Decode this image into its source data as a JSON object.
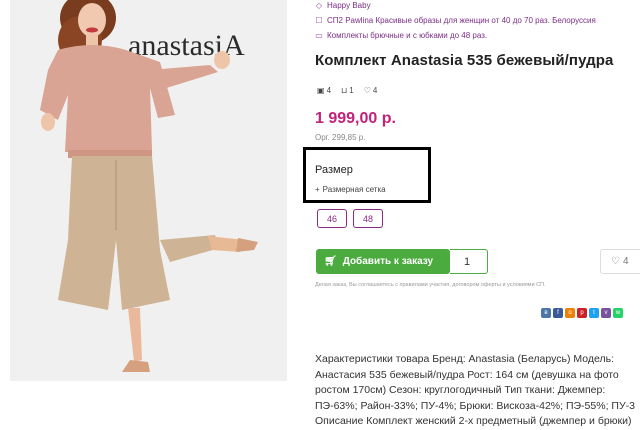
{
  "meta": {
    "brand_link": "Happy Baby",
    "purchase_link": "СП2 Pawlina Красивые образы для женщин от 40 до 70 раз. Белоруссия",
    "category_link": "Комплекты брючные и с юбками до 48 раз."
  },
  "product": {
    "title": "Комплект Anastasia 535 бежевый/пудра",
    "photo_logo": "anastasiA",
    "stats": {
      "photos": "4",
      "orders": "1",
      "likes": "4"
    },
    "price": "1 999,00 р.",
    "org_price": "Орг. 299,85 р."
  },
  "size": {
    "label": "Размер",
    "grid_link": "Размерная сетка",
    "options": [
      "46",
      "48"
    ]
  },
  "actions": {
    "add_label": "Добавить к заказу",
    "quantity": "1",
    "favorite_count": "4"
  },
  "disclaimer": "Делая заказ, Вы соглашаетесь с правилами участия, договором оферты и условиями СП.",
  "share": [
    {
      "icon": "vk-icon",
      "color": "#4a76a8",
      "glyph": "в"
    },
    {
      "icon": "facebook-icon",
      "color": "#3b5998",
      "glyph": "f"
    },
    {
      "icon": "odnoklassniki-icon",
      "color": "#ee8208",
      "glyph": "о"
    },
    {
      "icon": "pinterest-icon",
      "color": "#cb2027",
      "glyph": "p"
    },
    {
      "icon": "twitter-icon",
      "color": "#1da1f2",
      "glyph": "t"
    },
    {
      "icon": "viber-icon",
      "color": "#7b519d",
      "glyph": "v"
    },
    {
      "icon": "whatsapp-icon",
      "color": "#25d366",
      "glyph": "w"
    }
  ],
  "description": [
    "Характеристики товара Бренд: Anastasia (Беларусь) Модель:",
    "Анастасия 535 бежевый/пудра Рост: 164 см (девушка на фото",
    "ростом 170см) Сезон: круглогодичный Тип ткани: Джемпер:",
    "ПЭ-63%; Район-33%; ПУ-4%; Брюки: Вискоза-42%; ПЭ-55%; ПУ-3",
    "Описание Комплект женский 2-х предметный (джемпер и брюки)"
  ],
  "colors": {
    "accent": "#c2227a",
    "purple": "#8b2a83",
    "green": "#4bab3e"
  }
}
